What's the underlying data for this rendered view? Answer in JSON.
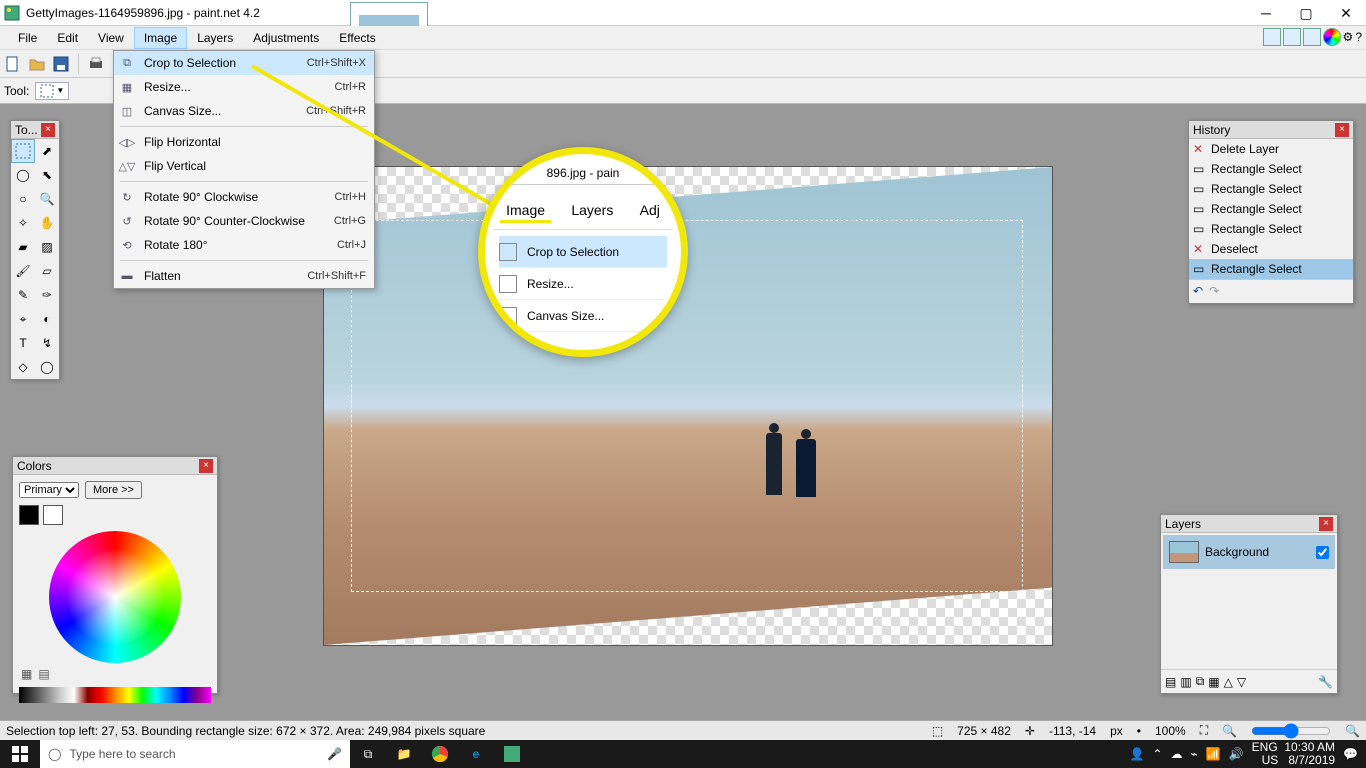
{
  "title": "GettyImages-1164959896.jpg - paint.net 4.2",
  "menubar": [
    "File",
    "Edit",
    "View",
    "Image",
    "Layers",
    "Adjustments",
    "Effects"
  ],
  "menubar_active_index": 3,
  "toolrow2_label": "Tool:",
  "dropdown": {
    "items": [
      {
        "label": "Crop to Selection",
        "shortcut": "Ctrl+Shift+X",
        "highlight": true
      },
      {
        "label": "Resize...",
        "shortcut": "Ctrl+R"
      },
      {
        "label": "Canvas Size...",
        "shortcut": "Ctrl+Shift+R"
      },
      {
        "sep": true
      },
      {
        "label": "Flip Horizontal",
        "shortcut": ""
      },
      {
        "label": "Flip Vertical",
        "shortcut": ""
      },
      {
        "sep": true
      },
      {
        "label": "Rotate 90° Clockwise",
        "shortcut": "Ctrl+H"
      },
      {
        "label": "Rotate 90° Counter-Clockwise",
        "shortcut": "Ctrl+G"
      },
      {
        "label": "Rotate 180°",
        "shortcut": "Ctrl+J"
      },
      {
        "sep": true
      },
      {
        "label": "Flatten",
        "shortcut": "Ctrl+Shift+F"
      }
    ]
  },
  "callout": {
    "title_fragment": "896.jpg - pain",
    "menus": [
      "Image",
      "Layers",
      "Adj"
    ],
    "items": [
      "Crop to Selection",
      "Resize...",
      "Canvas Size..."
    ]
  },
  "tools_panel_title": "To...",
  "colors_panel": {
    "title": "Colors",
    "primary_label": "Primary",
    "more_button": "More >>"
  },
  "history_panel": {
    "title": "History",
    "items": [
      {
        "label": "Delete Layer",
        "deleted": true
      },
      {
        "label": "Rectangle Select"
      },
      {
        "label": "Rectangle Select"
      },
      {
        "label": "Rectangle Select"
      },
      {
        "label": "Rectangle Select"
      },
      {
        "label": "Deselect",
        "deleted": true
      },
      {
        "label": "Rectangle Select",
        "selected": true
      }
    ]
  },
  "layers_panel": {
    "title": "Layers",
    "layers": [
      {
        "name": "Background",
        "visible": true
      }
    ]
  },
  "statusbar": {
    "selection": "Selection top left: 27, 53. Bounding rectangle size: 672 × 372. Area: 249,984 pixels square",
    "dimensions": "725 × 482",
    "cursor": "-113, -14",
    "units": "px",
    "zoom": "100%"
  },
  "taskbar": {
    "search_placeholder": "Type here to search",
    "lang1": "ENG",
    "lang2": "US",
    "time": "10:30 AM",
    "date": "8/7/2019"
  }
}
